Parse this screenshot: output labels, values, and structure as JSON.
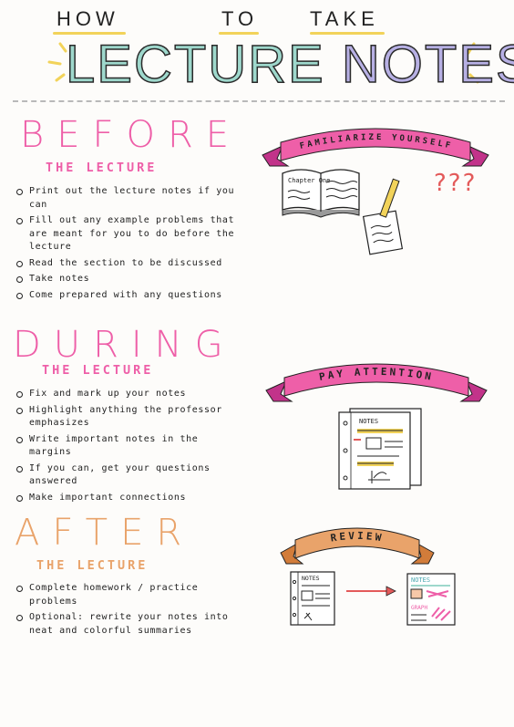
{
  "header": {
    "words": [
      "HOW",
      "TO",
      "TAKE"
    ],
    "title_word1": "LECTURE",
    "title_word2": "NOTES"
  },
  "colors": {
    "teal": "#9ed8cc",
    "lavender": "#b7b0e4",
    "yellow": "#f2d35a",
    "pink": "#ee5fa8",
    "orange": "#e9a36a"
  },
  "before": {
    "heading": "BEFORE",
    "subheading": "THE LECTURE",
    "items": [
      "Print out the lecture notes if you can",
      "Fill out any example problems that are meant for you to do before the lecture",
      "Read the section to be discussed",
      "Take notes",
      "Come prepared with any questions"
    ],
    "banner": "FAMILIARIZE YOURSELF",
    "book_label": "Chapter One",
    "question_marks": "???"
  },
  "during": {
    "heading": "DURING",
    "subheading": "THE LECTURE",
    "items": [
      "Fix and mark up your notes",
      "Highlight anything the professor emphasizes",
      "Write important notes in the margins",
      "If you can, get your questions answered",
      "Make important connections"
    ],
    "banner": "PAY ATTENTION",
    "notes_label": "NOTES"
  },
  "after": {
    "heading": "AFTER",
    "subheading": "THE LECTURE",
    "items": [
      "Complete homework / practice problems",
      "Optional: rewrite your notes into neat and colorful summaries"
    ],
    "banner": "REVIEW",
    "notes_label_left": "NOTES",
    "notes_label_right": "NOTES",
    "graph_label": "GRAPH"
  }
}
